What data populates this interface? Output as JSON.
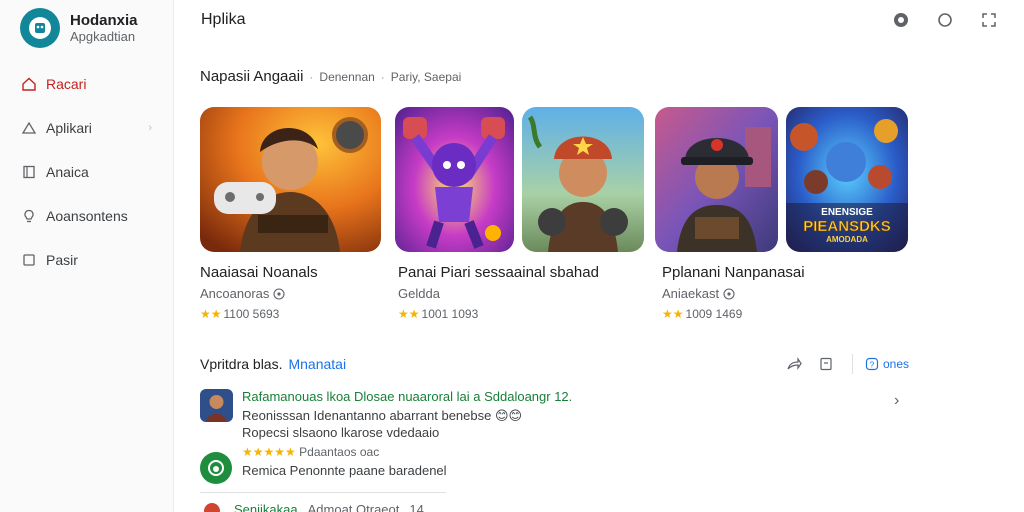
{
  "brand": {
    "name": "Hodanxia",
    "subtitle": "Apgkadtian"
  },
  "sidebar": {
    "items": [
      {
        "label": "Racari",
        "icon": "home-icon",
        "active": true
      },
      {
        "label": "Aplikari",
        "icon": "triangle-icon",
        "active": false
      },
      {
        "label": "Anaica",
        "icon": "book-icon",
        "active": false
      },
      {
        "label": "Aoansontens",
        "icon": "lightbulb-icon",
        "active": false
      },
      {
        "label": "Pasir",
        "icon": "square-icon",
        "active": false
      }
    ]
  },
  "header": {
    "title": "Hplika",
    "icons": [
      "chat-icon",
      "shield-icon",
      "expand-icon"
    ]
  },
  "section1": {
    "title": "Napasii Angaaii",
    "meta1": "Denennan",
    "meta2": "Pariy, Saepai"
  },
  "cards": [
    {
      "title": "Naaiasai Noanals",
      "developer": "Ancoanoras",
      "stars": "★★",
      "rating": "1100 5693"
    },
    {
      "title": "Panai Piari sessaainal sbahad",
      "developer": "Geldda",
      "stars": "★★",
      "rating": "1001 1093"
    },
    {
      "title": "Pplanani Nanpanasai",
      "developer": "Aniaekast",
      "stars": "★★",
      "rating": "1009 1469"
    }
  ],
  "game_art": {
    "poster_text_1": "ENENSIGE",
    "poster_text_2": "PIEANSDKS",
    "poster_text_3": "AMODADA"
  },
  "section2": {
    "title": "Vpritdra blas.",
    "link": "Mnanatai",
    "more_label": "ones"
  },
  "reviews": [
    {
      "headline": "Rafamanouas lkoa Dlosae nuaaroral lai a Sddaloangr 12.",
      "line1": "Reonisssan Idenantanno abarrant benebse 😊😊",
      "line2": "Ropecsi slsaono lkarose vdedaaio"
    }
  ],
  "review_meta": {
    "stars": "★★★★★",
    "text": "Pdaantaos oac"
  },
  "review2": {
    "text": "Remica Penonnte paane baradenel"
  },
  "review3": {
    "name": "Seniikakaa",
    "meta": "Admoat Otraeot",
    "extra": "14."
  }
}
